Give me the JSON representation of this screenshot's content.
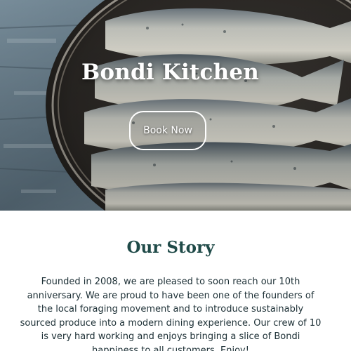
{
  "hero": {
    "title": "Bondi Kitchen",
    "book_button_label": "Book Now",
    "background_image": "sardines-on-plate"
  },
  "story": {
    "heading": "Our Story",
    "body": "Founded in 2008, we are pleased to soon reach our 10th anniversary. We are proud to have been one of the founders of the local foraging movement and to introduce sustainably sourced produce into a modern dining experience. Our crew of 10 is very hard working and enjoys bringing a slice of Bondi happiness to all customers. Enjoy!"
  },
  "colors": {
    "heading": "#1f4a48",
    "body_text": "#1c2f35",
    "hero_text": "#ffffff"
  }
}
